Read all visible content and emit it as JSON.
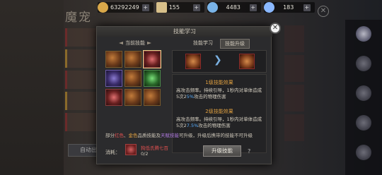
{
  "background": {
    "title": "魔宠",
    "bottom_button": "自动出战",
    "sidebar": [
      "",
      "",
      "",
      "",
      ""
    ]
  },
  "resources": [
    {
      "name": "coin-icon",
      "value": "63292249",
      "color": "#d9a84a"
    },
    {
      "name": "scroll-icon",
      "value": "155",
      "color": "#d8c08a"
    },
    {
      "name": "crystal-icon",
      "value": "4483",
      "color": "#7ab4e8"
    },
    {
      "name": "gem-icon",
      "value": "183",
      "color": "#8ab8ff"
    }
  ],
  "modal": {
    "title": "技能学习",
    "current_skills_label": "当前技能",
    "tabs": [
      {
        "label": "技能学习",
        "active": false
      },
      {
        "label": "技能升级",
        "active": true
      }
    ],
    "level2_title": "1级技能效果",
    "level2_text_a": "高攻击频率。持续引导，1秒内对单体造成5次2",
    "level2_text_hl": "5%",
    "level2_text_b": "攻击的物理伤害",
    "level3_title": "2级技能效果",
    "level3_text_a": "高攻击频率。持续引导，1秒内对单体造成5次2",
    "level3_text_hl": "7.5%",
    "level3_text_b": "攻击的物理伤害",
    "note_prefix": "部分",
    "note_red": "红色",
    "note_sep": "、",
    "note_gold": "金色",
    "note_mid": "品质技能及",
    "note_purple": "天赋技能",
    "note_suffix": "可升级，升级后携带的技能不可升级",
    "cost_label": "消耗：",
    "cost_item_name": "狗低氏腾七百",
    "cost_item_count": "0/2",
    "upgrade_button": "升级技能",
    "help": "?"
  },
  "colors": {
    "accent_gold": "#e0a040",
    "accent_blue": "#5ab0ff",
    "accent_red": "#e05050"
  }
}
